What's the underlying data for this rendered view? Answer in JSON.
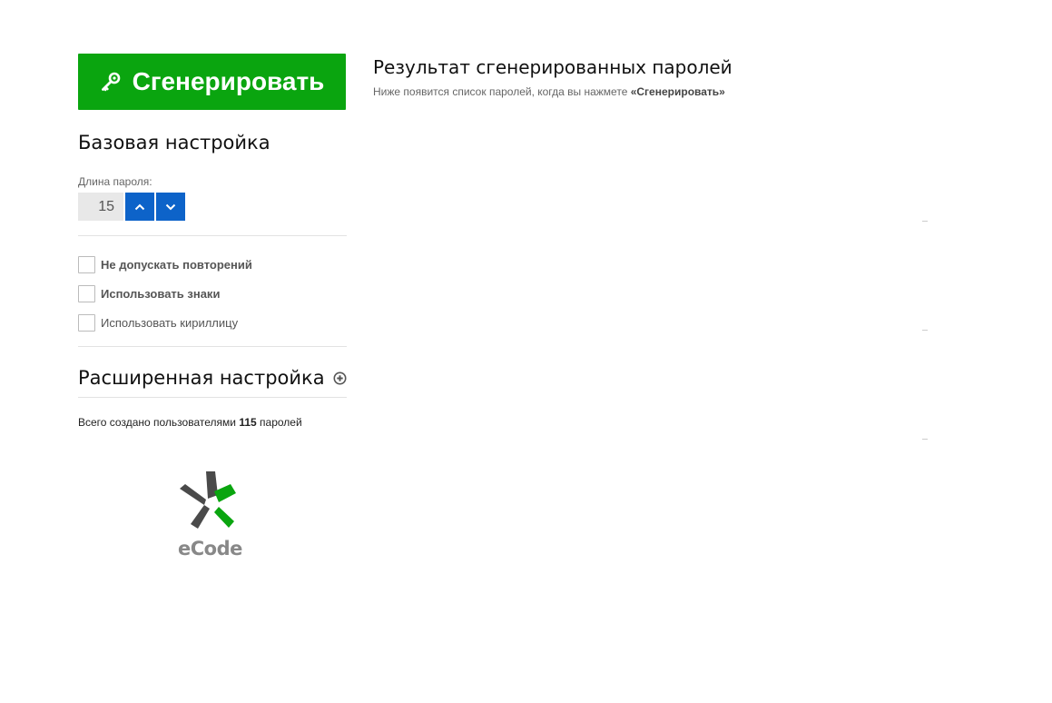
{
  "generate": {
    "label": "Сгенерировать",
    "color": "#0aa50f"
  },
  "base_settings": {
    "title": "Базовая настройка",
    "length_label": "Длина пароля:",
    "length_value": "15"
  },
  "options": [
    {
      "label": "Не допускать повторений",
      "checked": false
    },
    {
      "label": "Использовать знаки",
      "checked": false
    },
    {
      "label": "Использовать кириллицу",
      "checked": false
    }
  ],
  "advanced": {
    "title": "Расширенная настройка"
  },
  "stats": {
    "prefix": "Всего создано пользователями",
    "count": "115",
    "suffix": "паролей"
  },
  "logo": {
    "text": "eCode",
    "dark_color": "#4a4a4a",
    "accent_color": "#0aa50f"
  },
  "results": {
    "title": "Результат сгенерированных паролей",
    "hint_prefix": "Ниже появится список паролей, когда вы нажмете",
    "hint_emphasis": "«Сгенерировать»"
  },
  "icons": {
    "generate": "key-icon",
    "increase": "chevron-up-icon",
    "decrease": "chevron-down-icon",
    "advanced_toggle": "plus-circle-icon"
  }
}
